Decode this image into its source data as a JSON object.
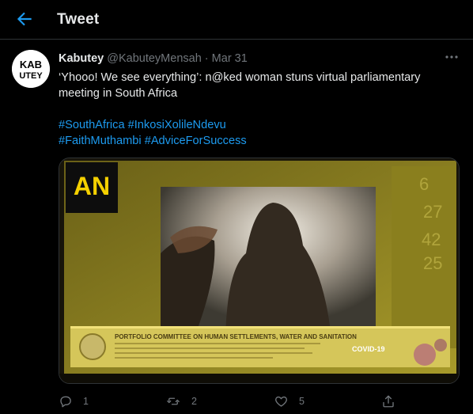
{
  "header": {
    "title": "Tweet"
  },
  "tweet": {
    "author_name": "Kabutey",
    "author_handle": "@KabuteyMensah",
    "separator": "·",
    "date": "Mar 31",
    "avatar_text": [
      "KAB",
      "UTEY"
    ],
    "text": "‘Yhooo! We see everything’: n@ked woman stuns virtual parliamentary meeting in South Africa",
    "hashtags": [
      "#SouthAfrica",
      "#InkosiXolileNdevu",
      "#FaithMuthambi",
      "#AdviceForSuccess"
    ]
  },
  "media": {
    "logo_text": "AN",
    "chyron_title": "PORTFOLIO COMMITTEE ON HUMAN SETTLEMENTS, WATER AND SANITATION",
    "covid_label": "COVID-19"
  },
  "actions": {
    "replies": "1",
    "retweets": "2",
    "likes": "5"
  },
  "colors": {
    "accent": "#1d9bf0",
    "muted": "#71767b",
    "background": "#000000"
  }
}
